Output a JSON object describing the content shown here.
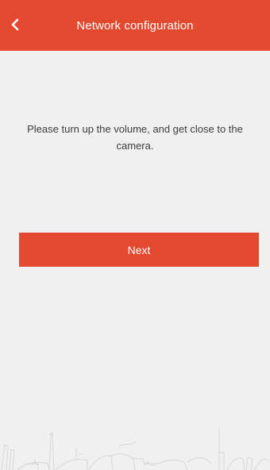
{
  "header": {
    "title": "Network configuration",
    "back_icon": "chevron-left-icon",
    "background_color": "#e2492f"
  },
  "main": {
    "instruction": "Please turn up the volume, and get close to the camera.",
    "next_label": "Next",
    "button_color": "#e2492f"
  },
  "decoration": {
    "skyline_icon": "city-skyline-illustration"
  }
}
